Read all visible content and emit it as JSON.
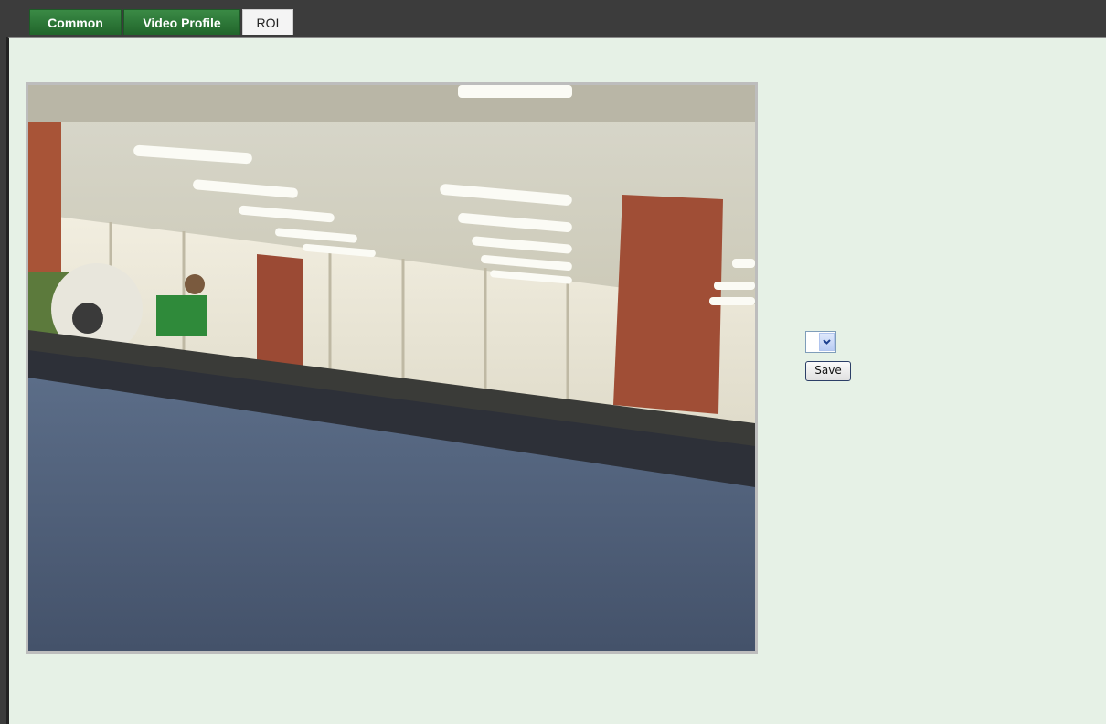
{
  "tabs": [
    {
      "label": "Common",
      "active": false
    },
    {
      "label": "Video Profile",
      "active": false
    },
    {
      "label": "ROI",
      "active": true
    }
  ],
  "roi": {
    "select_value": "",
    "save_label": "Save"
  },
  "colors": {
    "tab_green": "#2e7d3a",
    "panel_bg": "#e6f1e6",
    "top_bar": "#3c3c3c"
  },
  "icons": {
    "dropdown": "chevron-down-icon"
  }
}
